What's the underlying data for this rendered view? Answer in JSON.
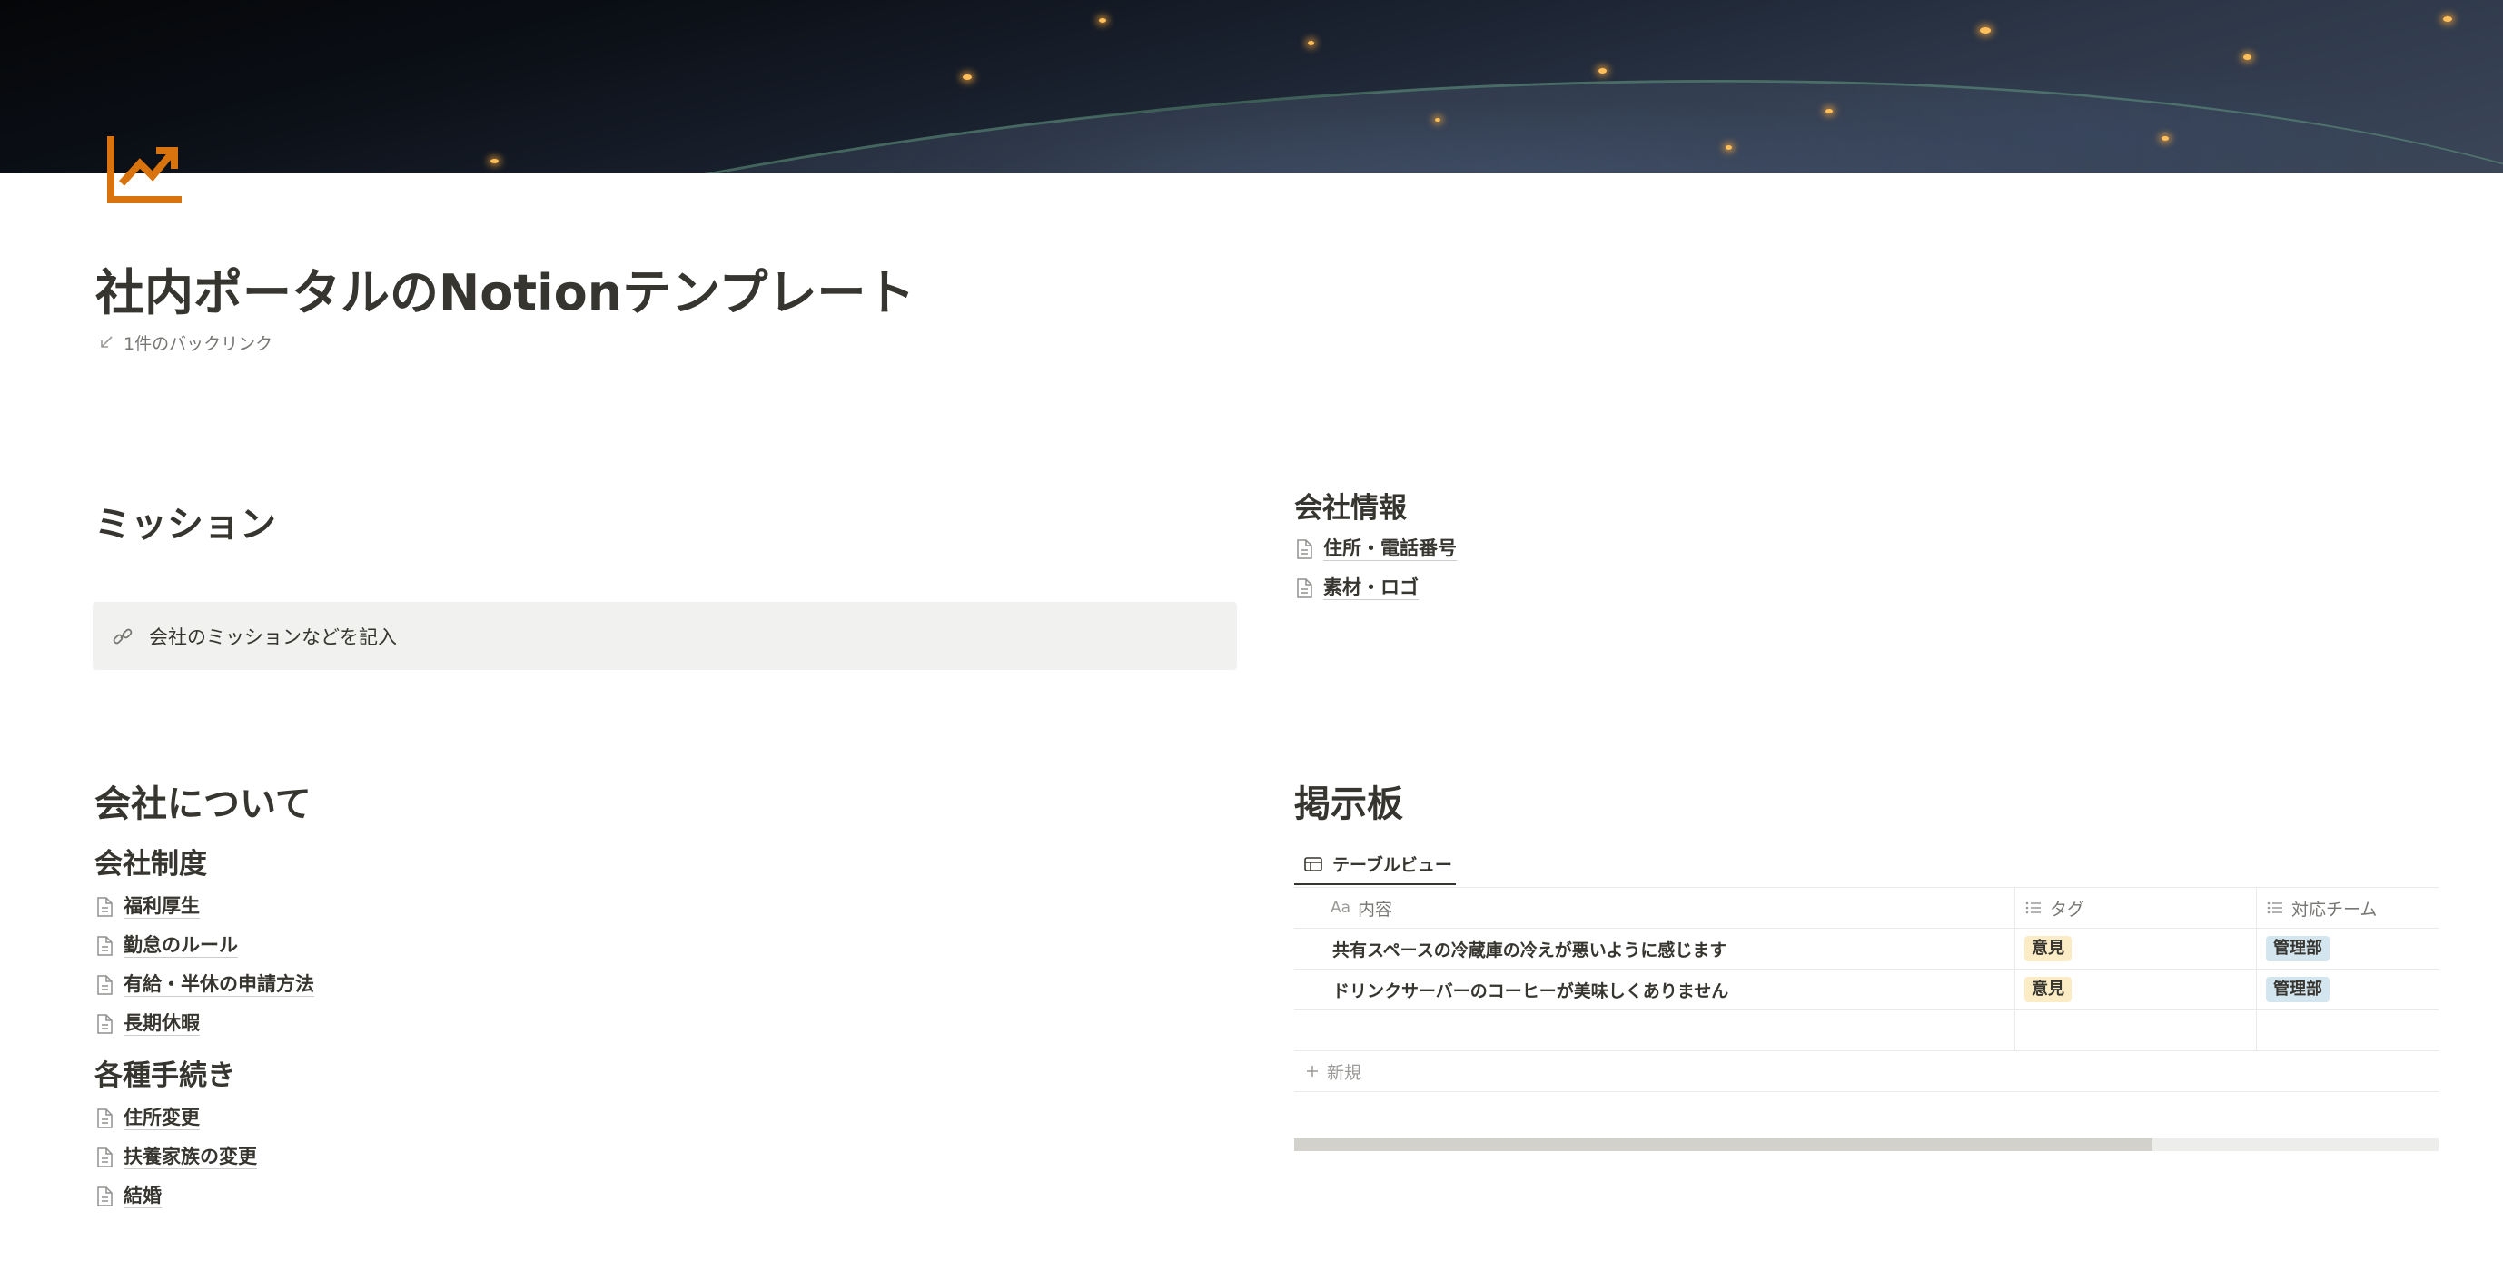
{
  "page": {
    "title": "社内ポータルのNotionテンプレート",
    "backlinks": "1件のバックリンク"
  },
  "colors": {
    "text": "#37352f",
    "icon_orange": "#d9730d",
    "callout_bg": "#f1f1ef",
    "tag_yellow": "#fbecc6",
    "tag_blue": "#d3e5ef"
  },
  "mission": {
    "heading": "ミッション",
    "callout_icon": "link-icon",
    "callout_text": "会社のミッションなどを記入"
  },
  "about": {
    "heading": "会社について",
    "policies": {
      "heading": "会社制度",
      "pages": [
        "福利厚生",
        "勤怠のルール",
        "有給・半休の申請方法",
        "長期休暇"
      ]
    },
    "procedures": {
      "heading": "各種手続き",
      "pages": [
        "住所変更",
        "扶養家族の変更",
        "結婚"
      ]
    }
  },
  "company_info": {
    "heading": "会社情報",
    "pages": [
      "住所・電話番号",
      "素材・ロゴ"
    ]
  },
  "board": {
    "heading": "掲示板",
    "view_tab": "テーブルビュー",
    "columns": {
      "content_prefix": "Aa",
      "content": "内容",
      "tag": "タグ",
      "team": "対応チーム"
    },
    "rows": [
      {
        "content": "共有スペースの冷蔵庫の冷えが悪いように感じます",
        "tag": "意見",
        "team": "管理部"
      },
      {
        "content": "ドリンクサーバーのコーヒーが美味しくありません",
        "tag": "意見",
        "team": "管理部"
      }
    ],
    "new_label": "新規",
    "scroll_fraction": 0.75
  }
}
